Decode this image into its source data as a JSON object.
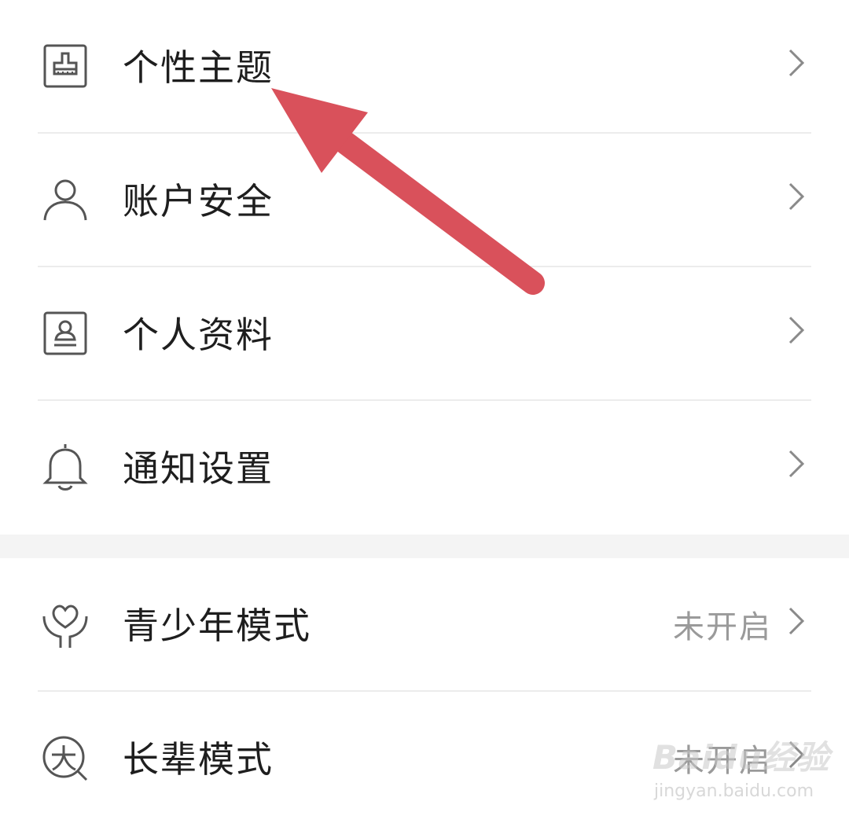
{
  "menu_group_1": [
    {
      "label": "个性主题",
      "icon": "theme-brush-icon"
    },
    {
      "label": "账户安全",
      "icon": "user-icon"
    },
    {
      "label": "个人资料",
      "icon": "profile-card-icon"
    },
    {
      "label": "通知设置",
      "icon": "bell-icon"
    }
  ],
  "menu_group_2": [
    {
      "label": "青少年模式",
      "status": "未开启",
      "icon": "youth-heart-icon"
    },
    {
      "label": "长辈模式",
      "status": "未开启",
      "icon": "elder-mode-icon"
    }
  ],
  "annotation": {
    "arrow_color": "#d9515b",
    "points_to": "个性主题"
  },
  "watermark": {
    "brand": "Baidu经验",
    "url": "jingyan.baidu.com"
  }
}
